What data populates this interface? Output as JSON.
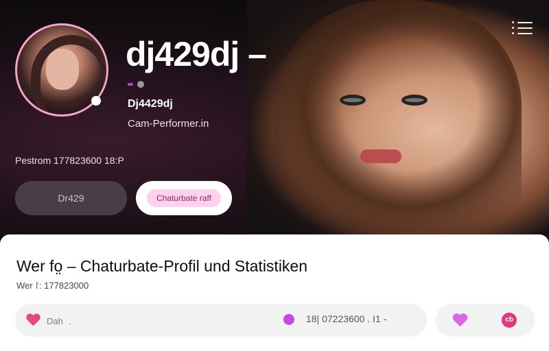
{
  "header": {
    "title": "dj429dj –",
    "handle": "Dj4429dj",
    "role": "Cam-Performer.in",
    "posts_text": "Pestrom  177823600  18:P",
    "menu_icon": "menu-icon"
  },
  "buttons": {
    "primary_label": "Dr429",
    "secondary_label": "Chaturbate raff"
  },
  "panel": {
    "title": "Wer fo̤ – Chaturbate-Profil und Statistiken",
    "subtitle": "Wer ⸷: 177823000"
  },
  "stats": {
    "label": "Dah ﹒",
    "value": "18|  07223600 .   I1  -"
  },
  "colors": {
    "accent_pink": "#f5a6c8",
    "accent_purple": "#c54be0",
    "heart": "#e54b7a",
    "brand": "#e0387c"
  }
}
